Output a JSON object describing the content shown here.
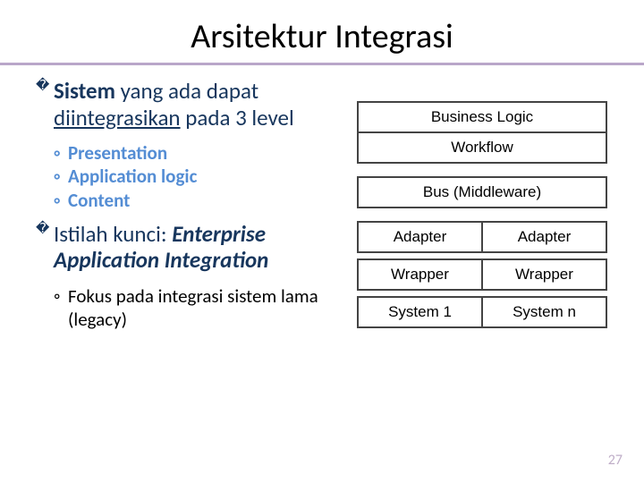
{
  "title": "Arsitektur Integrasi",
  "point1": {
    "bullet": "�",
    "text_before": "Sistem",
    "text_mid": " yang ada dapat ",
    "text_underline": "diintegrasikan",
    "text_after": " pada 3 level"
  },
  "sub1": {
    "a": "Presentation",
    "b": "Application logic",
    "c": "Content"
  },
  "point2": {
    "bullet": "�",
    "text_before": "Istilah kunci:",
    "text_em": "Enterprise Application Integration"
  },
  "sub2": {
    "a_before": "Fokus pada integrasi sistem lama (",
    "a_em": "legacy",
    "a_after": ")"
  },
  "diagram": {
    "r1": "Business Logic",
    "r2": "Workflow",
    "r3": "Bus (Middleware)",
    "r4a": "Adapter",
    "r4b": "Adapter",
    "r5a": "Wrapper",
    "r5b": "Wrapper",
    "r6a": "System 1",
    "r6b": "System n"
  },
  "pagenum": "27"
}
